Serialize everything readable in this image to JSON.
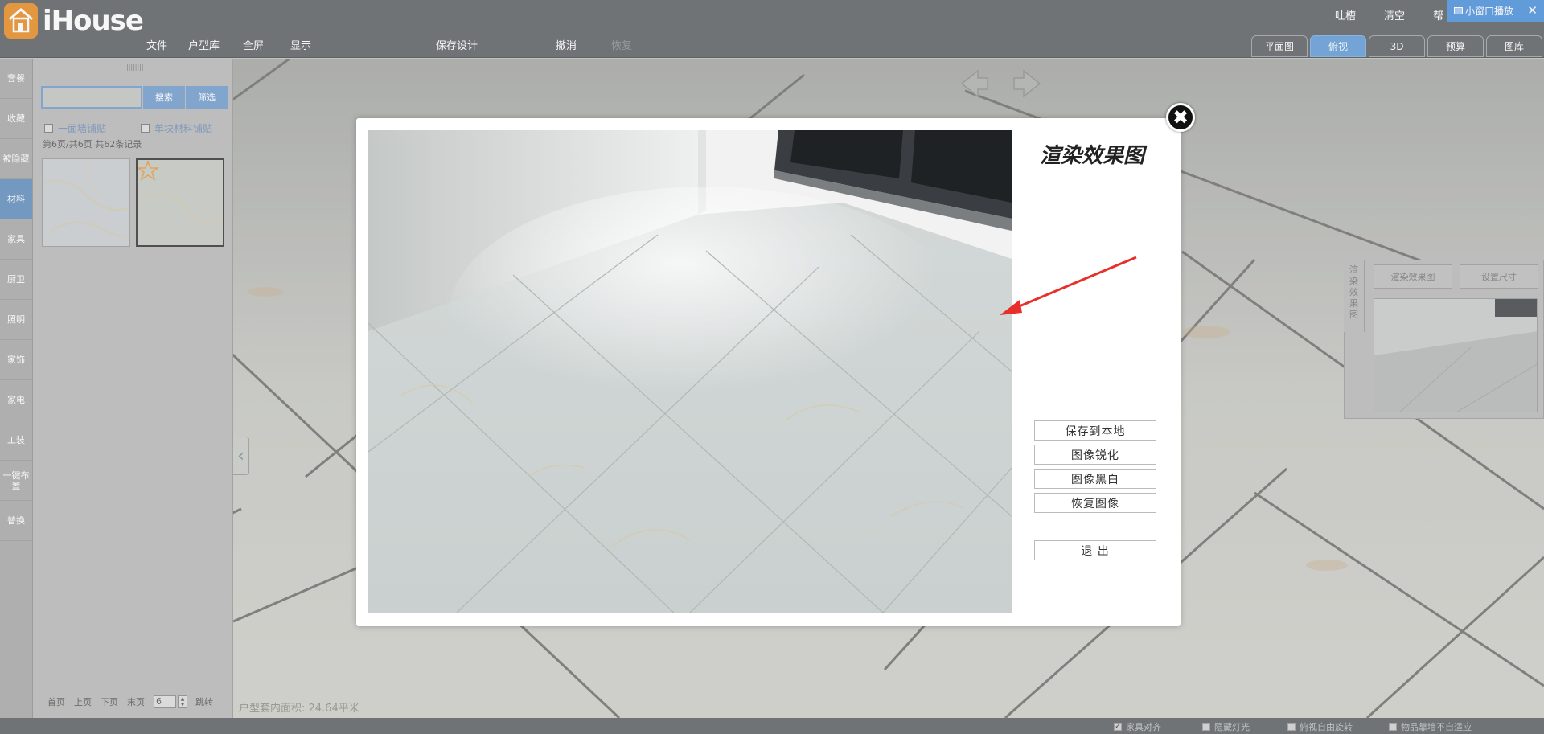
{
  "app": {
    "logo_text": "iHouse"
  },
  "menu": {
    "items": [
      "文件",
      "户型库",
      "全屏",
      "显示"
    ],
    "save": "保存设计",
    "undo": "撤消",
    "redo": "恢复"
  },
  "top_links": [
    "吐槽",
    "清空",
    "帮"
  ],
  "small_window": {
    "label": "小窗口播放",
    "close": "✕"
  },
  "view_tabs": [
    "平面图",
    "俯视",
    "3D",
    "预算",
    "图库"
  ],
  "active_view": "俯视",
  "sidebar": {
    "items": [
      "套餐",
      "收藏",
      "被隐藏",
      "材料",
      "家具",
      "厨卫",
      "照明",
      "家饰",
      "家电",
      "工装",
      "一键布置",
      "替换"
    ],
    "active": "材料"
  },
  "panel": {
    "search_placeholder": "",
    "search_btn": "搜索",
    "filter_btn": "筛选",
    "check1": "一面墙铺贴",
    "check2": "单块材料铺贴",
    "page_info": "第6页/共6页  共62条记录",
    "pager": {
      "first": "首页",
      "prev": "上页",
      "next": "下页",
      "last": "末页",
      "page_value": "6",
      "jump": "跳转"
    }
  },
  "area_text": "户型套内面积: 24.64平米",
  "right_panel": {
    "vtab": "渲染效果图",
    "btn1": "渲染效果图",
    "btn2": "设置尺寸"
  },
  "status": [
    "家具对齐",
    "隐藏灯光",
    "俯视自由旋转",
    "物品靠墙不自适应"
  ],
  "status_checked": [
    true,
    false,
    false,
    false
  ],
  "modal": {
    "title": "渲染效果图",
    "buttons": [
      "保存到本地",
      "图像锐化",
      "图像黑白",
      "恢复图像"
    ],
    "exit": "退 出",
    "close": "✖"
  },
  "colors": {
    "accent": "#5e9ad6",
    "topbar": "#5b5f62",
    "logo": "#e88a21",
    "annotation_arrow": "#e8302b"
  }
}
